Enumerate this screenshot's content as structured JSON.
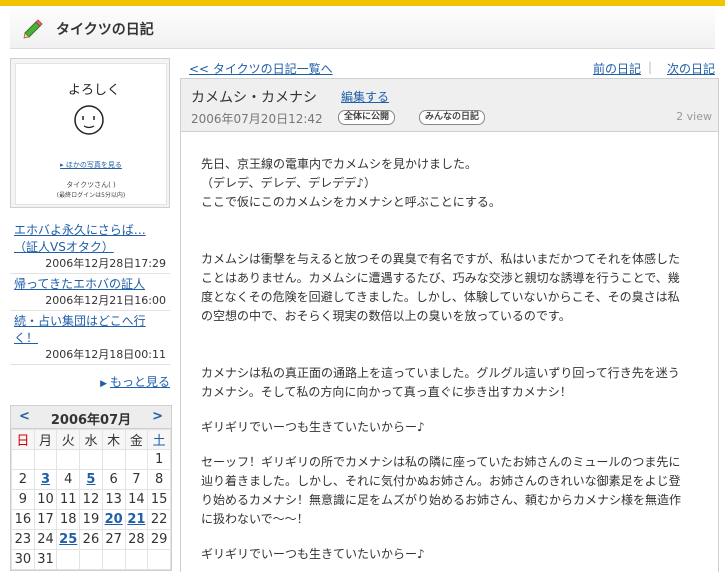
{
  "header": {
    "title": "タイクツの日記"
  },
  "profile": {
    "more_photos": "▸ ほかの写真を見る",
    "user_name": "タイクツさん( )",
    "last_login": "(最終ログインは5分以内)"
  },
  "recent": [
    {
      "title": "エホバよ永久にさらば…（証人VSオタク）",
      "date": "2006年12月28日17:29"
    },
    {
      "title": "帰ってきたエホバの証人",
      "date": "2006年12月21日16:00"
    },
    {
      "title": "続・占い集団はどこへ行く！",
      "date": "2006年12月18日00:11"
    }
  ],
  "more_label": "もっと見る",
  "calendar": {
    "prev": "<",
    "next": ">",
    "month": "2006年07月",
    "weekdays": [
      "日",
      "月",
      "火",
      "水",
      "木",
      "金",
      "土"
    ],
    "weeks": [
      [
        "",
        "",
        "",
        "",
        "",
        "",
        "1"
      ],
      [
        "2",
        "3",
        "4",
        "5",
        "6",
        "7",
        "8"
      ],
      [
        "9",
        "10",
        "11",
        "12",
        "13",
        "14",
        "15"
      ],
      [
        "16",
        "17",
        "18",
        "19",
        "20",
        "21",
        "22"
      ],
      [
        "23",
        "24",
        "25",
        "26",
        "27",
        "28",
        "29"
      ],
      [
        "30",
        "31",
        "",
        "",
        "",
        "",
        ""
      ]
    ],
    "linked_days": [
      "3",
      "5",
      "20",
      "21",
      "25"
    ]
  },
  "nav": {
    "back": "<< タイクツの日記一覧へ",
    "prev": "前の日記",
    "separator": "|",
    "next": "次の日記"
  },
  "entry": {
    "title": "カメムシ・カメナシ",
    "edit": "編集する",
    "date": "2006年07月20日12:42",
    "badge_public": "全体に公開",
    "badge_diary": "みんなの日記",
    "views": "2 view",
    "para1": [
      "先日、京王線の電車内でカメムシを見かけました。",
      "（デレデ、デレデ、デレデデ♪）",
      "ここで仮にこのカメムシをカメナシと呼ぶことにする。"
    ],
    "para2": [
      "カメムシは衝撃を与えると放つその異臭で有名ですが、私はいまだかつてそれを体感した",
      "ことはありません。カメムシに遭遇するたび、巧みな交渉と親切な誘導を行うことで、幾",
      "度となくその危険を回避してきました。しかし、体験していないからこそ、その臭さは私",
      "の空想の中で、おそらく現実の数倍以上の臭いを放っているのです。"
    ],
    "para3": [
      "カメナシは私の真正面の通路上を這っていました。グルグル這いずり回って行き先を迷う",
      "カメナシ。そして私の方向に向かって真っ直ぐに歩き出すカメナシ！"
    ],
    "para4": "ギリギリでいーつも生きていたいからー♪",
    "para5": [
      "セーッフ！ギリギリの所でカメナシは私の隣に座っていたお姉さんのミュールのつま先に",
      "辿り着きました。しかし、それに気付かぬお姉さん。お姉さんのきれいな御素足をよじ登",
      "り始めるカメナシ！無意識に足をムズがり始めるお姉さん、頼むからカメナシ様を無造作",
      "に扱わないで〜〜！"
    ],
    "para6": "ギリギリでいーつも生きていたいからー♪"
  },
  "colors": {
    "accent_bar": "#f2c300",
    "link": "#1f5fa8",
    "sunday": "#d10000"
  }
}
